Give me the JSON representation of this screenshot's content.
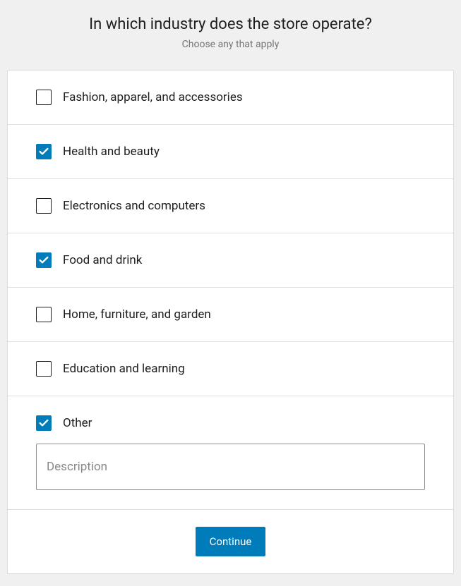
{
  "header": {
    "title": "In which industry does the store operate?",
    "subtitle": "Choose any that apply"
  },
  "options": [
    {
      "label": "Fashion, apparel, and accessories",
      "checked": false
    },
    {
      "label": "Health and beauty",
      "checked": true
    },
    {
      "label": "Electronics and computers",
      "checked": false
    },
    {
      "label": "Food and drink",
      "checked": true
    },
    {
      "label": "Home, furniture, and garden",
      "checked": false
    },
    {
      "label": "Education and learning",
      "checked": false
    },
    {
      "label": "Other",
      "checked": true
    }
  ],
  "description": {
    "placeholder": "Description",
    "value": ""
  },
  "footer": {
    "continue_label": "Continue"
  }
}
